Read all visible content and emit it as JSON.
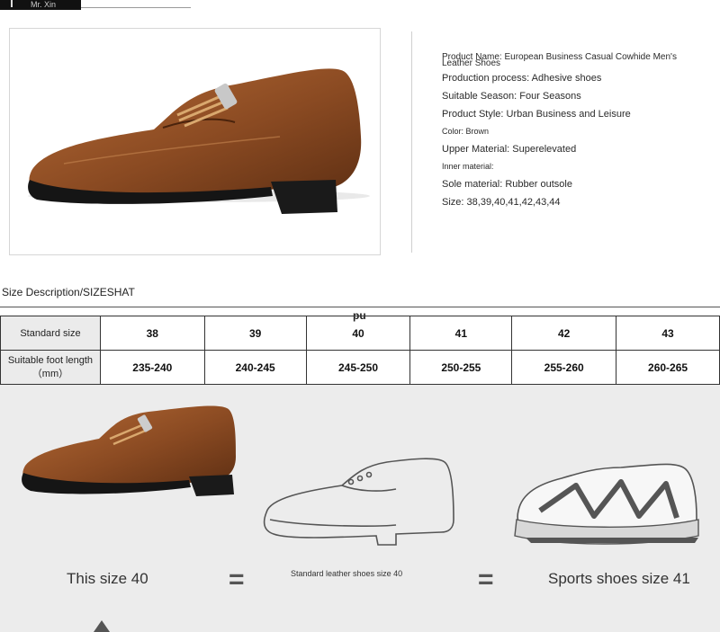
{
  "brand": {
    "name": "Mr. Xin"
  },
  "product": {
    "specs": [
      {
        "key": "Product Name:",
        "value": "European Business Casual Cowhide Men's Leather Shoes",
        "small": false
      },
      {
        "key": "Production process:",
        "value": "Adhesive shoes",
        "small": false
      },
      {
        "key": "Suitable Season:",
        "value": "Four Seasons",
        "small": false
      },
      {
        "key": "Product Style:",
        "value": "Urban Business and Leisure",
        "small": false
      },
      {
        "key": "Color:",
        "value": "Brown",
        "small": true
      },
      {
        "key": "Upper Material:",
        "value": "Superelevated",
        "small": false
      },
      {
        "key": "Inner material:",
        "value": "",
        "small": true
      },
      {
        "key": "Sole material:",
        "value": "Rubber outsole",
        "small": false
      },
      {
        "key": "Size:",
        "value": "38,39,40,41,42,43,44",
        "small": false
      }
    ]
  },
  "size_table": {
    "title": "Size Description/SIZESHAT",
    "note": "pu",
    "row1_label": "Standard size",
    "row2_label": "Suitable foot length（mm）",
    "sizes": [
      "38",
      "39",
      "40",
      "41",
      "42",
      "43"
    ],
    "lengths": [
      "235-240",
      "240-245",
      "245-250",
      "250-255",
      "255-260",
      "260-265"
    ]
  },
  "comparison": {
    "left_caption": "This size 40",
    "middle_caption": "Standard leather shoes size 40",
    "right_caption": "Sports shoes size 41",
    "equals": "="
  },
  "colors": {
    "leather": "#8a4a22",
    "panel": "#ececec"
  }
}
